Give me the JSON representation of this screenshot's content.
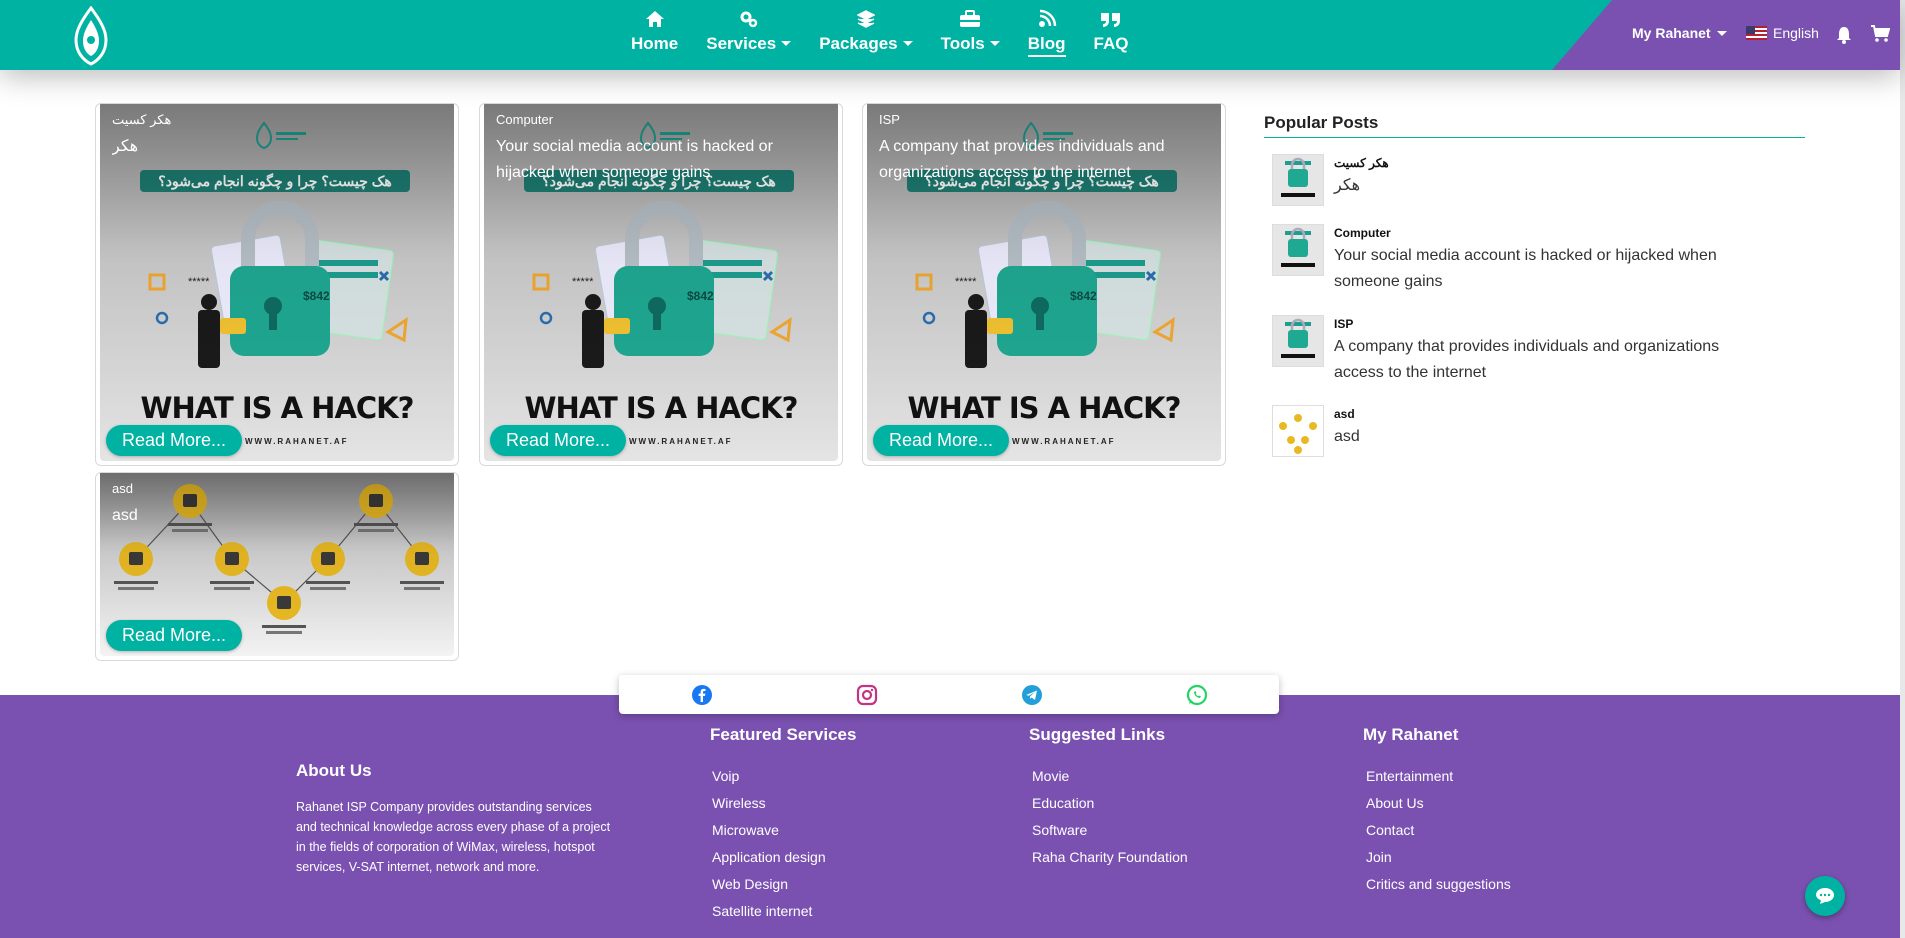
{
  "header": {
    "nav": [
      {
        "label": "Home",
        "icon": "home-icon",
        "dropdown": false,
        "active": false
      },
      {
        "label": "Services",
        "icon": "gears-icon",
        "dropdown": true,
        "active": false
      },
      {
        "label": "Packages",
        "icon": "layers-icon",
        "dropdown": true,
        "active": false
      },
      {
        "label": "Tools",
        "icon": "toolbox-icon",
        "dropdown": true,
        "active": false
      },
      {
        "label": "Blog",
        "icon": "blog-rss-icon",
        "dropdown": false,
        "active": true
      },
      {
        "label": "FAQ",
        "icon": "quote-icon",
        "dropdown": false,
        "active": false
      }
    ],
    "account_label": "My Rahanet",
    "language": "English"
  },
  "cards": [
    {
      "category": "هکر کسیت",
      "title": "هکر",
      "read_more": "Read More...",
      "image": "what-is-a-hack",
      "headline": "WHAT IS A HACK?",
      "url": "WWW.RAHANET.AF",
      "fa_banner": "هک چیست؟ چرا و چگونه انجام می‌شود؟"
    },
    {
      "category": "Computer",
      "title": "Your social media account is hacked or hijacked when someone gains",
      "read_more": "Read More...",
      "image": "what-is-a-hack",
      "headline": "WHAT IS A HACK?",
      "url": "WWW.RAHANET.AF",
      "fa_banner": "هک چیست؟ چرا و چگونه انجام می‌شود؟"
    },
    {
      "category": "ISP",
      "title": "A company that provides individuals and organizations access to the internet",
      "read_more": "Read More...",
      "image": "what-is-a-hack",
      "headline": "WHAT IS A HACK?",
      "url": "WWW.RAHANET.AF",
      "fa_banner": "هک چیست؟ چرا و چگونه انجام می‌شود؟"
    },
    {
      "category": "asd",
      "title": "asd",
      "read_more": "Read More...",
      "image": "process-diagram"
    }
  ],
  "popular": {
    "title": "Popular Posts",
    "items": [
      {
        "category": "هکر کسیت",
        "text": "هکر",
        "thumb": "what-is-a-hack"
      },
      {
        "category": "Computer",
        "text": "Your social media account is hacked or hijacked when someone gains",
        "thumb": "what-is-a-hack"
      },
      {
        "category": "ISP",
        "text": "A company that provides individuals and organizations access to the internet",
        "thumb": "what-is-a-hack"
      },
      {
        "category": "asd",
        "text": "asd",
        "thumb": "process-diagram"
      }
    ]
  },
  "social": [
    {
      "name": "facebook-icon",
      "color": "#1877f2"
    },
    {
      "name": "instagram-icon",
      "color": "#c13584"
    },
    {
      "name": "telegram-icon",
      "color": "#229ed9"
    },
    {
      "name": "whatsapp-icon",
      "color": "#25d366"
    }
  ],
  "footer": {
    "about": {
      "title": "About Us",
      "text": "Rahanet ISP Company provides outstanding services and technical knowledge across every phase of a project in the fields of corporation of WiMax, wireless, hotspot services, V-SAT internet, network and more."
    },
    "featured": {
      "title": "Featured Services",
      "links": [
        "Voip",
        "Wireless",
        "Microwave",
        "Application design",
        "Web Design",
        "Satellite internet"
      ]
    },
    "suggested": {
      "title": "Suggested Links",
      "links": [
        "Movie",
        "Education",
        "Software",
        "Raha Charity Foundation"
      ]
    },
    "my_rahanet": {
      "title": "My Rahanet",
      "links": [
        "Entertainment",
        "About Us",
        "Contact",
        "Join",
        "Critics and suggestions"
      ]
    }
  },
  "colors": {
    "teal": "#00b2a2",
    "purple": "#7a51b0"
  }
}
